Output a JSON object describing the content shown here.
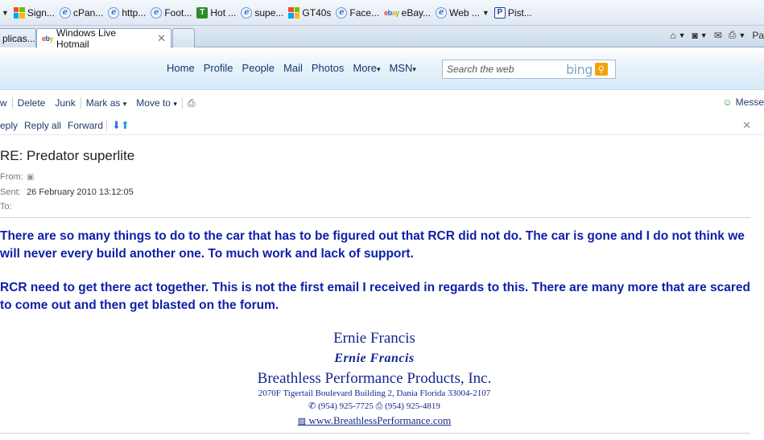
{
  "favorites": [
    {
      "label": "Sign...",
      "icon": "windows-icon"
    },
    {
      "label": "cPan...",
      "icon": "ie-page-icon"
    },
    {
      "label": "http...",
      "icon": "ie-page-icon"
    },
    {
      "label": "Foot...",
      "icon": "ie-page-icon"
    },
    {
      "label": "Hot ...",
      "icon": "t-logo-icon"
    },
    {
      "label": "supe...",
      "icon": "ie-page-icon"
    },
    {
      "label": "GT40s",
      "icon": "windows-icon"
    },
    {
      "label": "Face...",
      "icon": "ie-page-icon"
    },
    {
      "label": "eBay...",
      "icon": "ebay-icon"
    },
    {
      "label": "Web ...",
      "icon": "ie-page-icon"
    },
    {
      "label": "Pist...",
      "icon": "p-logo-icon"
    }
  ],
  "tabs": [
    {
      "label": "plicas..."
    },
    {
      "label": "Windows Live Hotmail"
    }
  ],
  "command_bar": {
    "page_label": "Pa"
  },
  "hotmail_nav": [
    "Home",
    "Profile",
    "People",
    "Mail",
    "Photos",
    "More",
    "MSN"
  ],
  "search": {
    "placeholder": "Search the web",
    "brand": "bing"
  },
  "toolbar1": {
    "new_label": "w",
    "delete_label": "Delete",
    "junk_label": "Junk",
    "mark_as_label": "Mark as",
    "move_to_label": "Move to",
    "messenger_label": "Messe"
  },
  "toolbar2": {
    "reply_label": "eply",
    "reply_all_label": "Reply all",
    "forward_label": "Forward"
  },
  "message": {
    "subject": "RE: Predator superlite",
    "from_label": "From:",
    "sent_label": "Sent:",
    "sent_value": "26 February 2010 13:12:05",
    "to_label": "To:",
    "paragraphs": [
      "There are so many things to do to the car that has to be figured out that RCR did not do. The car is gone and I do not think we will never every build another one. To much work and lack of support.",
      "RCR need to get there act together. This is not the first email I received in regards to this.  There are many more that are scared to come out and then get blasted on the forum."
    ],
    "signature": {
      "name": "Ernie Francis",
      "script": "Ernie Francis",
      "company": "Breathless Performance Products, Inc.",
      "address": "2070F Tigertail Boulevard Building 2, Dania Florida 33004-2107",
      "phone": "(954) 925-7725",
      "fax": "(954) 925-4819",
      "website": "www.BreathlessPerformance.com"
    }
  },
  "colors": {
    "body_text": "#0d1fa8",
    "signature": "#12278f",
    "nav_text": "#15386a",
    "bing_button": "#f5a20a"
  }
}
